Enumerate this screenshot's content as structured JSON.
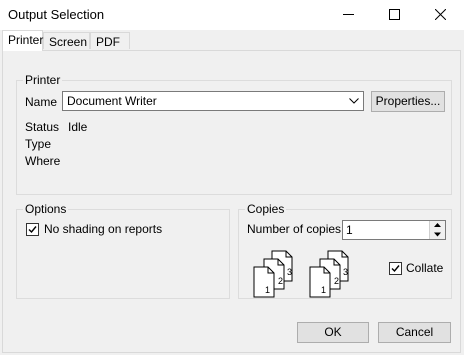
{
  "window": {
    "title": "Output Selection",
    "minimize_icon": "minimize-icon",
    "maximize_icon": "maximize-icon",
    "close_icon": "close-icon"
  },
  "tabs": [
    {
      "label": "Printer",
      "active": true
    },
    {
      "label": "Screen",
      "active": false
    },
    {
      "label": "PDF",
      "active": false
    }
  ],
  "printer_group": {
    "legend": "Printer",
    "name_label": "Name",
    "name_value": "Document Writer",
    "properties_button": "Properties...",
    "status_label": "Status",
    "status_value": "Idle",
    "type_label": "Type",
    "type_value": "",
    "where_label": "Where",
    "where_value": ""
  },
  "options_group": {
    "legend": "Options",
    "no_shading_label": "No shading on reports",
    "no_shading_checked": true
  },
  "copies_group": {
    "legend": "Copies",
    "number_label": "Number of copies:",
    "number_value": "1",
    "collate_label": "Collate",
    "collate_checked": true,
    "page_numbers": [
      "1",
      "2",
      "3"
    ]
  },
  "buttons": {
    "ok": "OK",
    "cancel": "Cancel"
  },
  "colors": {
    "dialog_background": "#f0f0f0",
    "titlebar_background": "#ffffff",
    "button_background": "#e1e1e1",
    "button_border": "#adadad"
  }
}
